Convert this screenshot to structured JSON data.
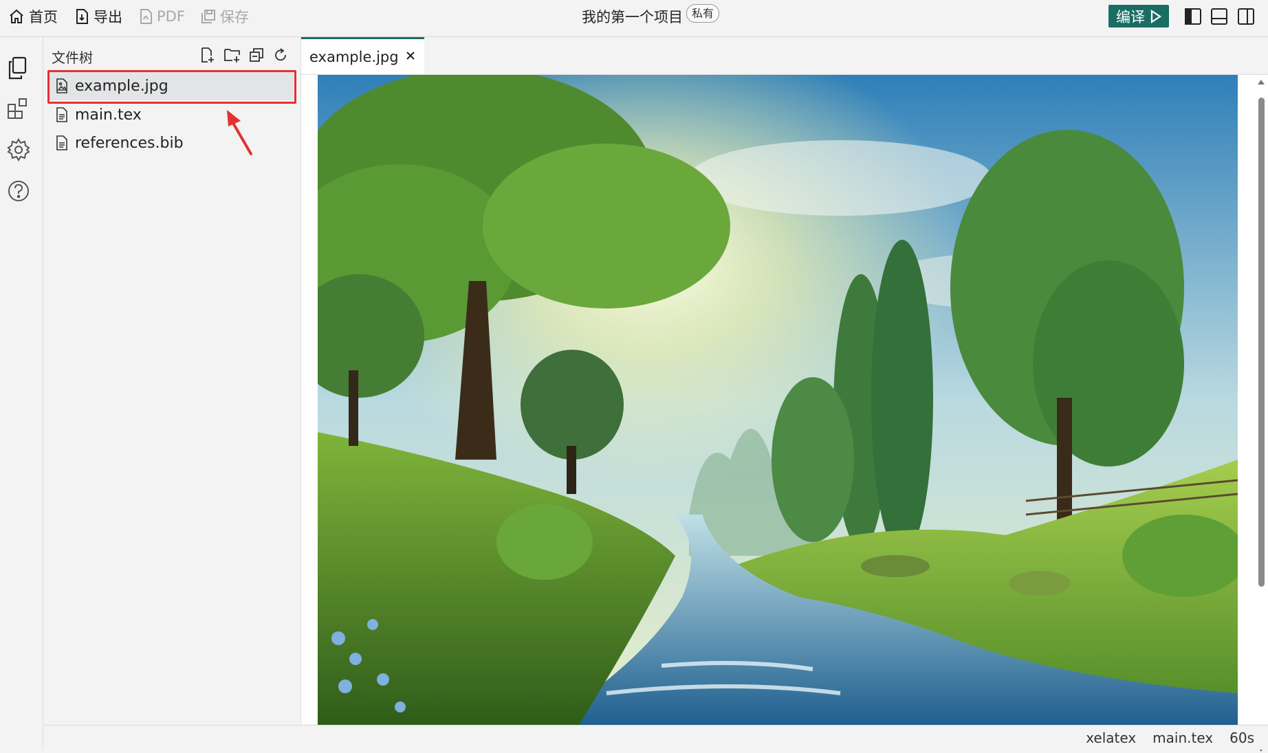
{
  "topbar": {
    "home": "首页",
    "export": "导出",
    "pdf": "PDF",
    "save": "保存",
    "project_title": "我的第一个项目",
    "visibility_badge": "私有",
    "compile": "编译",
    "layout_icons": [
      "sidebar-left-icon",
      "panel-bottom-icon",
      "split-columns-icon"
    ]
  },
  "activity_bar": {
    "icons": [
      "files-icon",
      "extensions-icon",
      "settings-gear-icon",
      "help-icon"
    ]
  },
  "file_tree": {
    "title": "文件树",
    "tools": [
      "new-file-icon",
      "new-folder-icon",
      "collapse-all-icon",
      "refresh-icon"
    ],
    "files": [
      {
        "name": "example.jpg",
        "selected": true
      },
      {
        "name": "main.tex",
        "selected": false
      },
      {
        "name": "references.bib",
        "selected": false
      }
    ]
  },
  "editor": {
    "tabs": [
      {
        "label": "example.jpg",
        "active": true
      }
    ],
    "preview_alt": "landscape-image"
  },
  "status_bar": {
    "compiler": "xelatex",
    "main_file": "main.tex",
    "timeout": "60s"
  },
  "colors": {
    "accent": "#1a6d63",
    "highlight": "#e53030",
    "selected_row": "#e3e4e6"
  }
}
